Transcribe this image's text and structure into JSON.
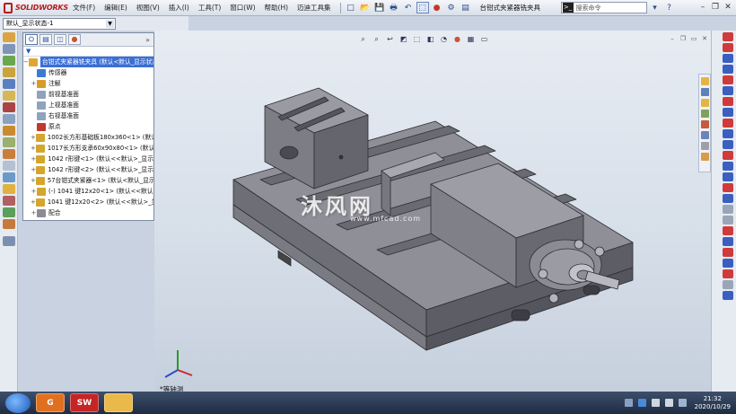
{
  "app": {
    "logo_text": "SOLIDWORKS",
    "brand_color": "#b41e1e"
  },
  "menu": [
    "文件(F)",
    "编辑(E)",
    "视图(V)",
    "插入(I)",
    "工具(T)",
    "窗口(W)",
    "帮助(H)",
    "迈迪工具集"
  ],
  "document_title": "台钳式夹紧器铣夹具",
  "search": {
    "placeholder": "搜索命令"
  },
  "config": {
    "selected": "默认_显示状态-1"
  },
  "feature_manager": {
    "filter_symbol": "▼",
    "root": "台钳式夹紧器铣夹具 (默认<默认_显示状态-1>)",
    "items": [
      {
        "label": "传感器",
        "expandable": false
      },
      {
        "label": "注解",
        "expandable": true
      },
      {
        "label": "前视基准面",
        "expandable": false
      },
      {
        "label": "上视基准面",
        "expandable": false
      },
      {
        "label": "右视基准面",
        "expandable": false
      },
      {
        "label": "原点",
        "expandable": false
      },
      {
        "label": "1002长方形基础板180x360<1> (默认",
        "expandable": true
      },
      {
        "label": "1017长方形支承60x90x80<1> (默认",
        "expandable": true
      },
      {
        "label": "1042 r形键<1> (默认<<默认>_显示",
        "expandable": true
      },
      {
        "label": "1042 r形键<2> (默认<<默认>_显示",
        "expandable": true
      },
      {
        "label": "57台钳式夹紧器<1> (默认<默认_显示",
        "expandable": true
      },
      {
        "label": "(-) 1041 键12x20<1> (默认<<默认",
        "expandable": true
      },
      {
        "label": "1041 键12x20<2> (默认<<默认>_显",
        "expandable": true
      },
      {
        "label": "配合",
        "expandable": true
      }
    ]
  },
  "viewport": {
    "view_label": "*等轴测",
    "watermark": "沐风网",
    "watermark_url": "www.mfcad.com"
  },
  "taskbar": {
    "time": "21:32",
    "date": "2020/10/29",
    "apps": [
      "G",
      "SW",
      ""
    ]
  }
}
